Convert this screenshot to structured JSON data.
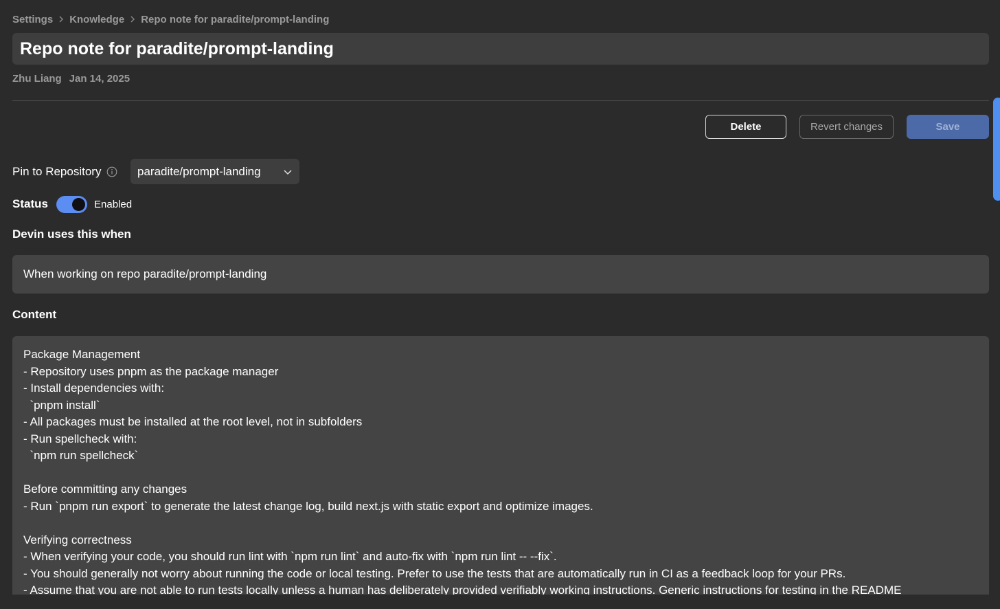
{
  "breadcrumb": {
    "items": [
      "Settings",
      "Knowledge",
      "Repo note for paradite/prompt-landing"
    ]
  },
  "note": {
    "title": "Repo note for paradite/prompt-landing",
    "author": "Zhu Liang",
    "date": "Jan 14, 2025"
  },
  "actions": {
    "delete_label": "Delete",
    "revert_label": "Revert changes",
    "save_label": "Save"
  },
  "pin": {
    "label": "Pin to Repository",
    "selected_repo": "paradite/prompt-landing",
    "info_icon": "info-icon",
    "dropdown_icon": "chevron-down-icon"
  },
  "status": {
    "label": "Status",
    "toggle_on": true,
    "value_text": "Enabled",
    "accent_color": "#5c8df2"
  },
  "trigger": {
    "label": "Devin uses this when",
    "text": "When working on repo paradite/prompt-landing"
  },
  "content": {
    "label": "Content",
    "lines": [
      "Package Management",
      "- Repository uses pnpm as the package manager",
      "- Install dependencies with:",
      "  `pnpm install`",
      "- All packages must be installed at the root level, not in subfolders",
      "- Run spellcheck with:",
      "  `npm run spellcheck`",
      "",
      "Before committing any changes",
      "- Run `pnpm run export` to generate the latest change log, build next.js with static export and optimize images.",
      "",
      "Verifying correctness",
      "- When verifying your code, you should run lint with `npm run lint` and auto-fix with `npm run lint -- --fix`.",
      "- You should generally not worry about running the code or local testing. Prefer to use the tests that are automatically run in CI as a feedback loop for your PRs.",
      "- Assume that you are not able to run tests locally unless a human has deliberately provided verifiably working instructions. Generic instructions for testing in the README"
    ]
  },
  "colors": {
    "background": "#2b2b2b",
    "field_background": "#444444",
    "save_button": "#4c6aa8"
  }
}
